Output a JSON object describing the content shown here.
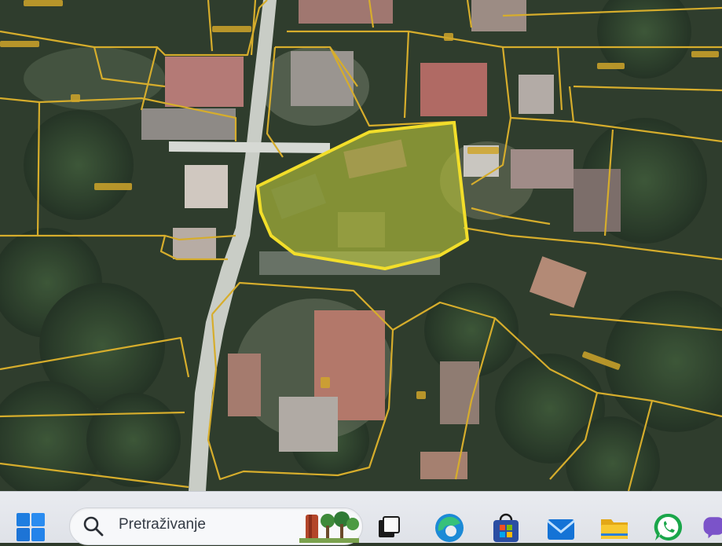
{
  "map": {
    "highlight_color": "#f2de2a",
    "boundary_color": "#d6ad2c",
    "highlight_fill": "#b8c43a"
  },
  "taskbar": {
    "start_icon": "windows-start-icon",
    "search": {
      "placeholder": "Pretraživanje",
      "icon": "search-icon",
      "art": "trees-illustration"
    },
    "apps": [
      {
        "name": "task-view-icon"
      },
      {
        "name": "edge-browser-icon"
      },
      {
        "name": "microsoft-store-icon"
      },
      {
        "name": "mail-icon"
      },
      {
        "name": "file-explorer-icon"
      },
      {
        "name": "whatsapp-icon"
      },
      {
        "name": "viber-icon"
      }
    ]
  }
}
